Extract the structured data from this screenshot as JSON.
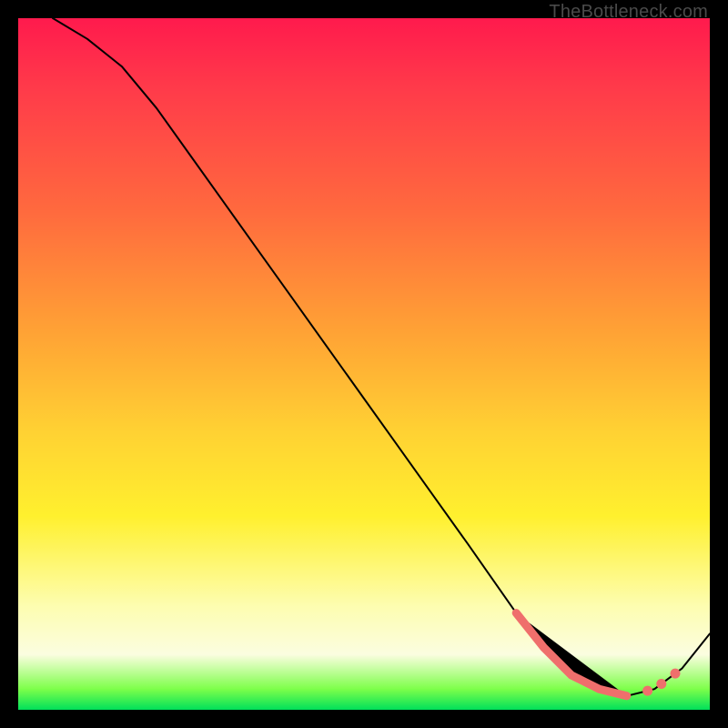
{
  "attribution": "TheBottleneck.com",
  "chart_data": {
    "type": "line",
    "title": "",
    "xlabel": "",
    "ylabel": "",
    "xlim": [
      0,
      100
    ],
    "ylim": [
      0,
      100
    ],
    "grid": false,
    "series": [
      {
        "name": "curve",
        "x": [
          5,
          10,
          15,
          20,
          25,
          30,
          35,
          40,
          45,
          50,
          55,
          60,
          65,
          72,
          76,
          80,
          84,
          88,
          92,
          96,
          100
        ],
        "y": [
          100,
          97,
          93,
          87,
          80,
          73,
          66,
          59,
          52,
          45,
          38,
          31,
          24,
          14,
          9,
          5,
          3,
          2,
          3,
          6,
          11
        ]
      }
    ],
    "markers": {
      "segment": {
        "x0": 72,
        "x1": 88
      },
      "points_x": [
        91,
        93,
        95
      ]
    },
    "background_gradient": {
      "stops": [
        {
          "pos": 0,
          "color": "#ff1a4d"
        },
        {
          "pos": 28,
          "color": "#ff6a3e"
        },
        {
          "pos": 60,
          "color": "#ffd233"
        },
        {
          "pos": 85,
          "color": "#fdfdb0"
        },
        {
          "pos": 100,
          "color": "#00e05a"
        }
      ]
    }
  }
}
